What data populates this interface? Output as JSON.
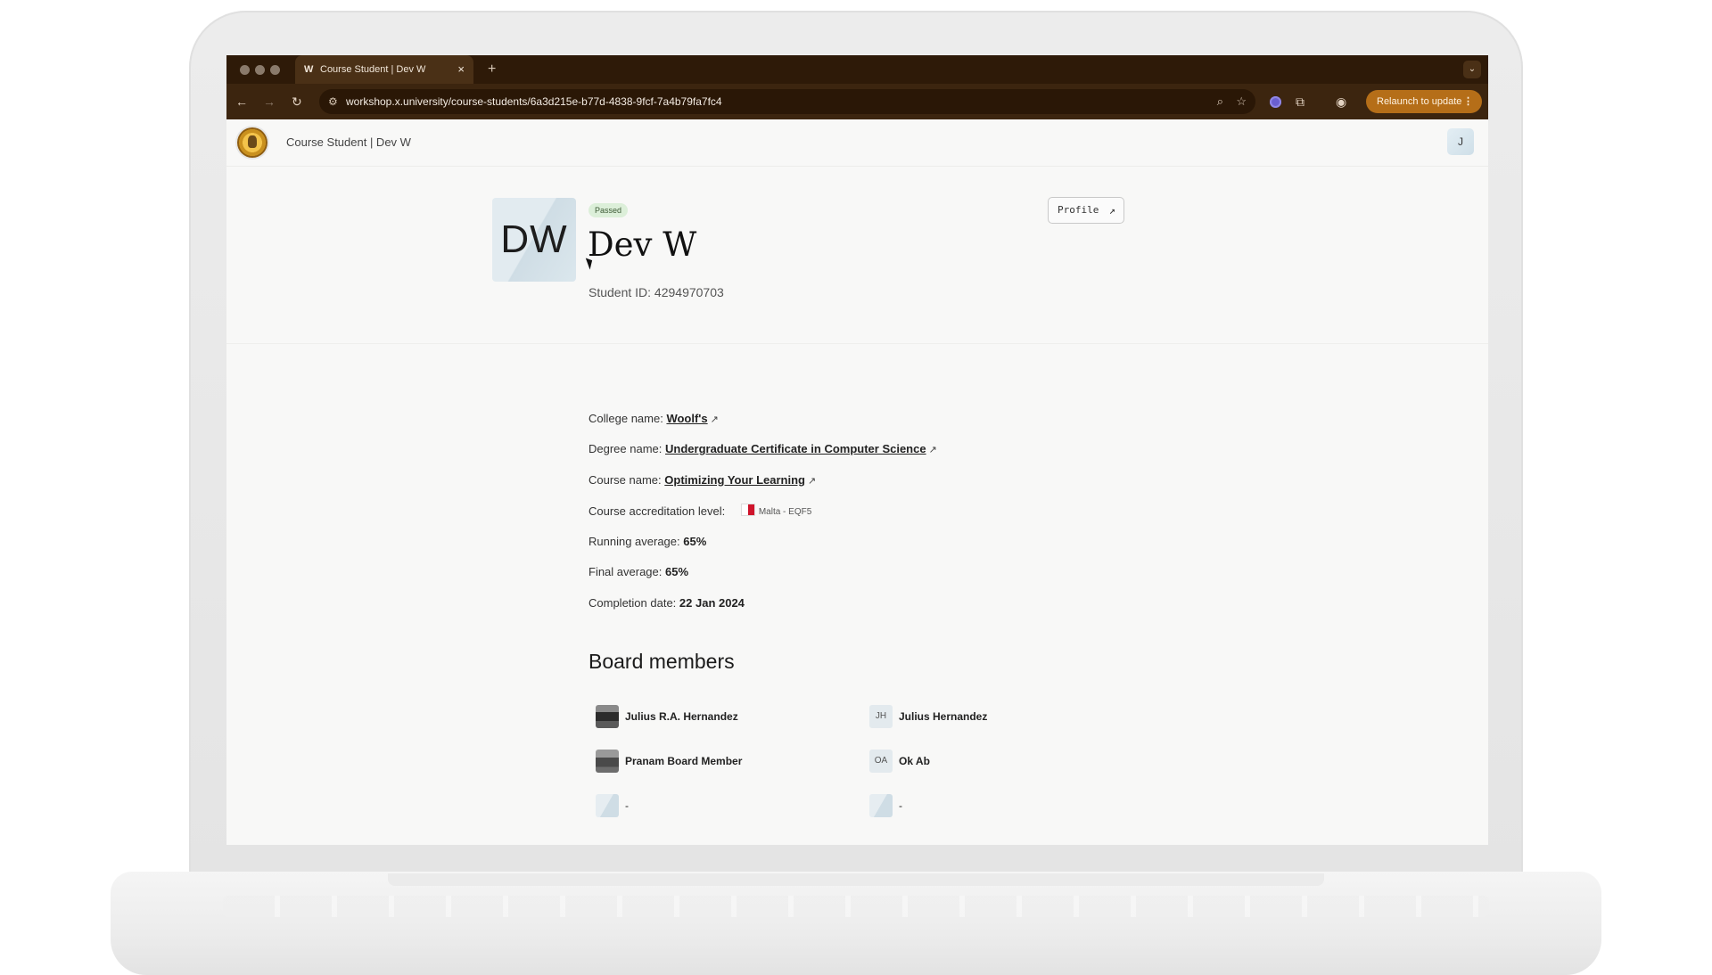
{
  "browser": {
    "tab_title": "Course Student | Dev W",
    "tab_favicon": "W",
    "tab_close": "×",
    "new_tab": "+",
    "tab_menu": "⌄",
    "url": "workshop.x.university/course-students/6a3d215e-b77d-4838-9fcf-7a4b79fa7fc4",
    "relaunch_label": "Relaunch to update"
  },
  "app_header": {
    "title": "Course Student | Dev W",
    "user_initial": "J"
  },
  "student": {
    "initials": "DW",
    "status": "Passed",
    "name": "Dev W",
    "id_text": "Student ID: 4294970703",
    "profile_button": "Profile"
  },
  "details": {
    "college_label": "College name:",
    "college_value": "Woolf's",
    "degree_label": "Degree name:",
    "degree_value": "Undergraduate Certificate in Computer Science",
    "course_label": "Course name:",
    "course_value": "Optimizing Your Learning",
    "accreditation_label": "Course accreditation level:",
    "accreditation_value": "Malta - EQF5",
    "running_label": "Running average:",
    "running_value": "65%",
    "final_label": "Final average:",
    "final_value": "65%",
    "completion_label": "Completion date:",
    "completion_value": "22 Jan 2024"
  },
  "board": {
    "title": "Board members",
    "members": [
      {
        "name": "Julius R.A. Hernandez",
        "initials": ""
      },
      {
        "name": "Julius Hernandez",
        "initials": "JH"
      },
      {
        "name": "Pranam Board Member",
        "initials": ""
      },
      {
        "name": "Ok Ab",
        "initials": "OA"
      },
      {
        "name": "-",
        "initials": ""
      },
      {
        "name": "-",
        "initials": ""
      }
    ]
  },
  "colors": {
    "browser_frame": "#2e1a08",
    "toolbar": "#3c250f",
    "relaunch": "#b56e18",
    "passed_badge": "#dcefd9"
  }
}
